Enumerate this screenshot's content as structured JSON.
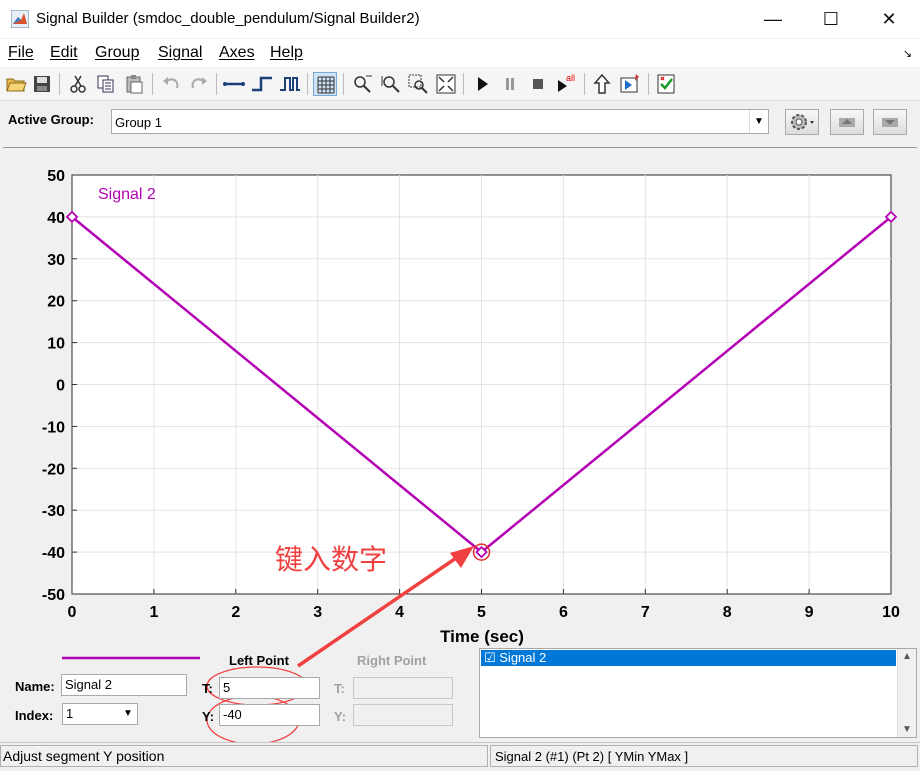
{
  "window": {
    "title": "Signal Builder (smdoc_double_pendulum/Signal Builder2)",
    "minimize": "—",
    "maximize": "☐",
    "close": "✕"
  },
  "menu": [
    "File",
    "Edit",
    "Group",
    "Signal",
    "Axes",
    "Help"
  ],
  "menu_underline_index": [
    0,
    0,
    0,
    0,
    0,
    0
  ],
  "group_bar": {
    "label": "Active Group:",
    "value": "Group 1"
  },
  "annotation": {
    "text": "键入数字",
    "color": "#f04040"
  },
  "chart_data": {
    "type": "line",
    "x": [
      0,
      5,
      10
    ],
    "series": [
      {
        "name": "Signal 2",
        "values": [
          40,
          -40,
          40
        ],
        "color": "#b400b4"
      }
    ],
    "xlabel": "Time (sec)",
    "ylabel": "",
    "xlim": [
      0,
      10
    ],
    "ylim": [
      -50,
      50
    ],
    "xticks": [
      "0",
      "1",
      "2",
      "3",
      "4",
      "5",
      "6",
      "7",
      "8",
      "9",
      "10"
    ],
    "yticks": [
      "50",
      "40",
      "30",
      "20",
      "10",
      "0",
      "-10",
      "-20",
      "-30",
      "-40",
      "-50"
    ],
    "grid": true,
    "selected_point_index": 1
  },
  "bottom": {
    "left_point_label": "Left Point",
    "right_point_label": "Right Point",
    "name_label": "Name:",
    "name_value": "Signal 2",
    "index_label": "Index:",
    "index_value": "1",
    "t_label": "T:",
    "t_value": "5",
    "y_label": "Y:",
    "y_value": "-40",
    "rt_label": "T:",
    "ry_label": "Y:"
  },
  "signal_list": {
    "items": [
      "☑ Signal 2"
    ]
  },
  "status": {
    "left": "Adjust segment Y position",
    "right": "Signal 2 (#1) (Pt 2)  [ YMin YMax ]"
  }
}
